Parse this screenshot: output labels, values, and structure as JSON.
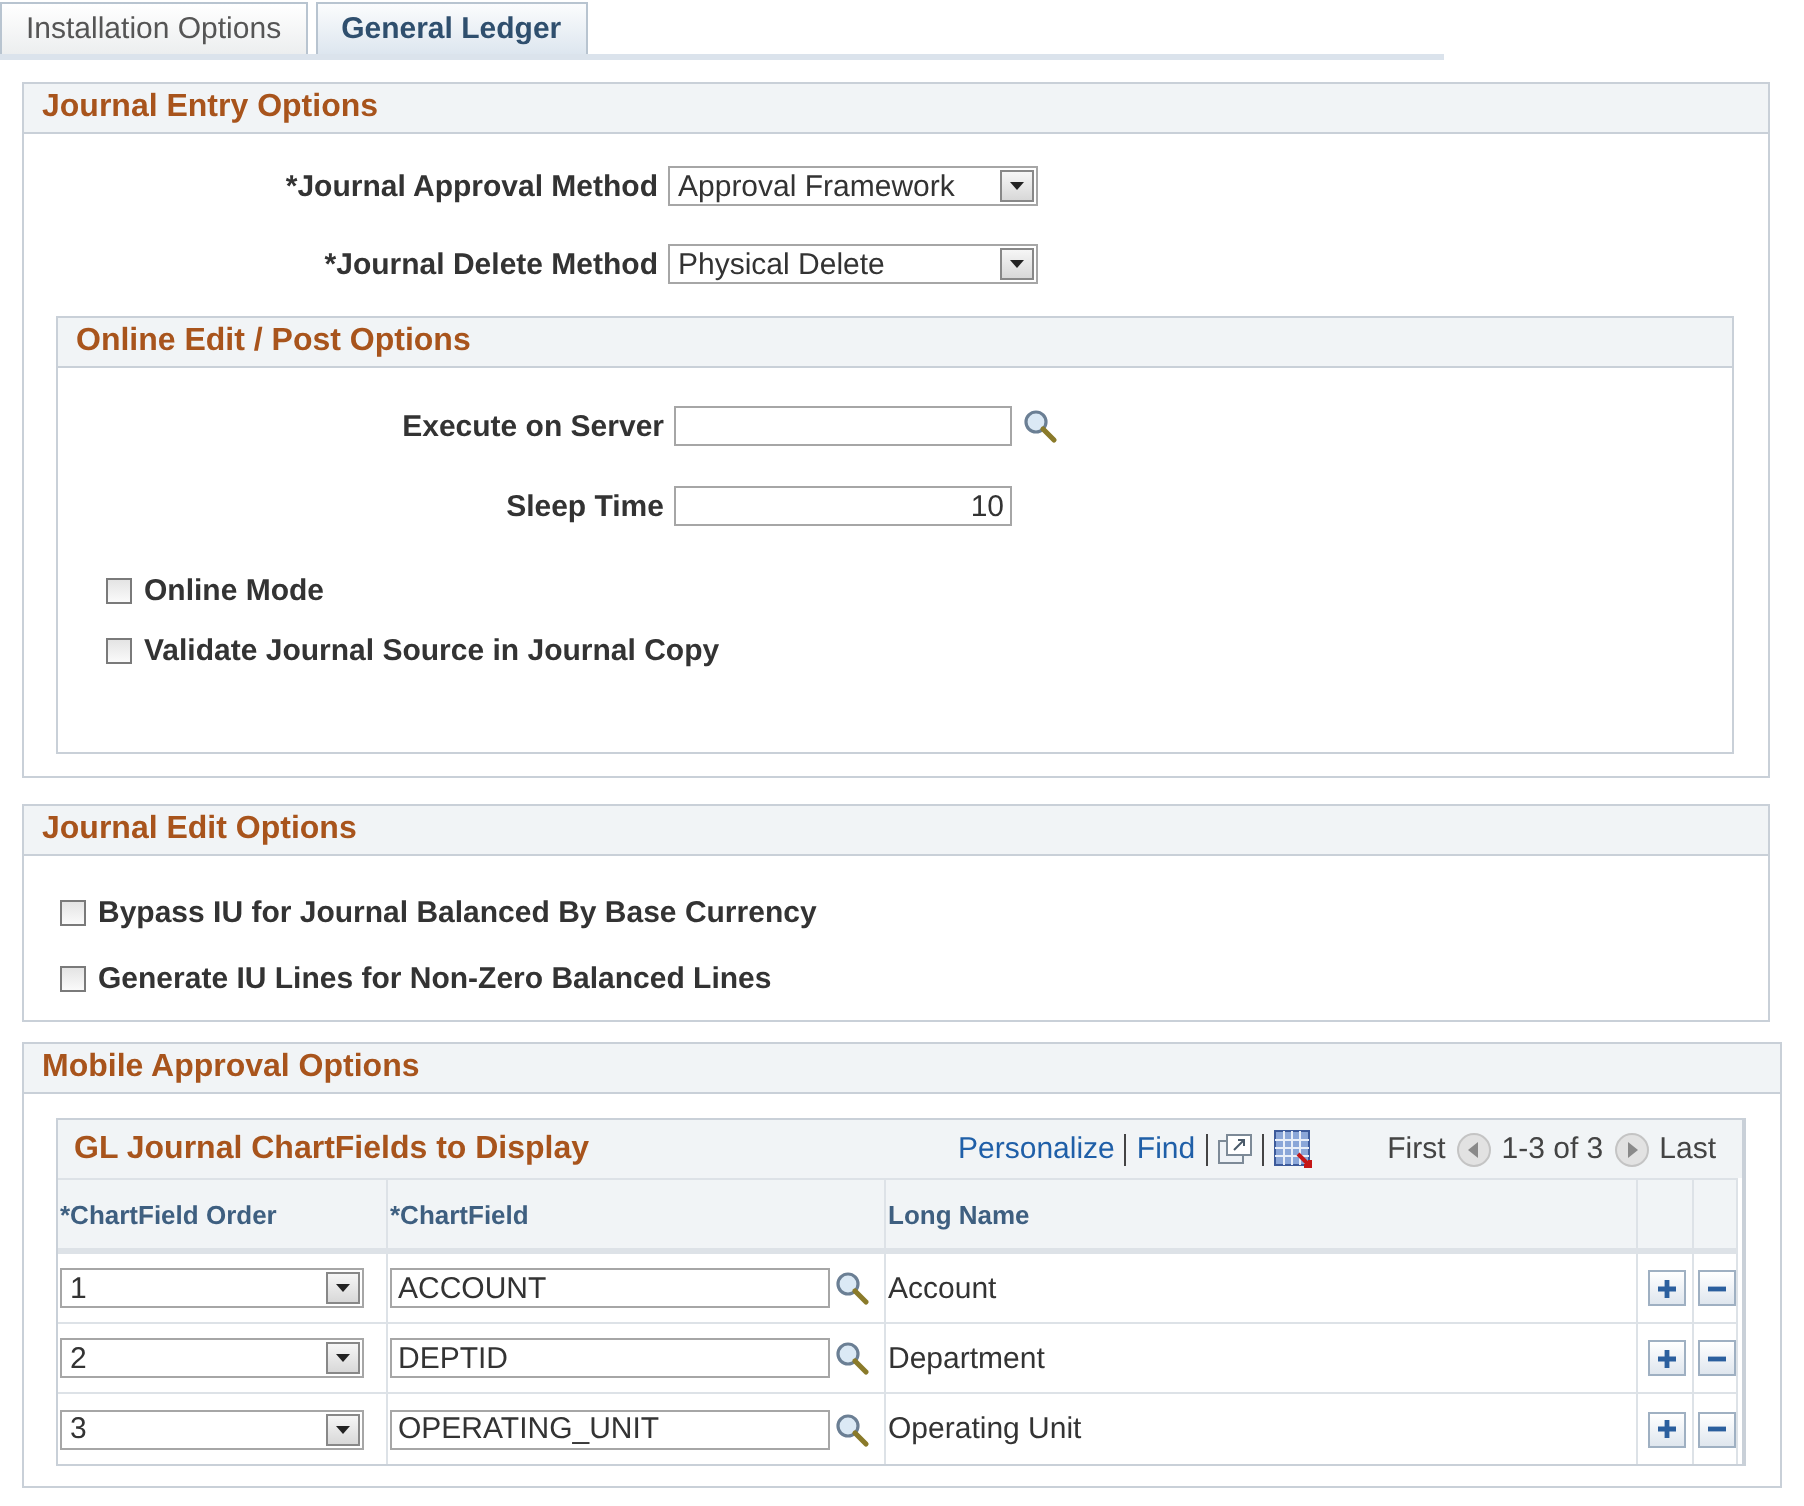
{
  "tabs": [
    {
      "label": "Installation Options",
      "selected": false
    },
    {
      "label": "General Ledger",
      "selected": true
    }
  ],
  "journal_entry": {
    "title": "Journal Entry Options",
    "fields": [
      {
        "label": "*Journal Approval Method",
        "value": "Approval Framework"
      },
      {
        "label": "*Journal Delete Method",
        "value": "Physical Delete"
      }
    ],
    "online_edit": {
      "title": "Online Edit / Post Options",
      "fields": [
        {
          "label": "Execute on Server",
          "kind": "lookup"
        },
        {
          "label": "Sleep Time",
          "value": "10",
          "kind": "number"
        }
      ],
      "checkboxes": [
        {
          "label": "Online Mode",
          "checked": false
        },
        {
          "label": "Validate Journal Source in Journal Copy",
          "checked": false
        }
      ]
    }
  },
  "journal_edit": {
    "title": "Journal Edit Options",
    "checkboxes": [
      {
        "label": "Bypass IU for Journal Balanced By Base Currency",
        "checked": false
      },
      {
        "label": "Generate IU Lines for Non-Zero Balanced Lines",
        "checked": false
      }
    ]
  },
  "mobile_approval": {
    "title": "Mobile Approval Options",
    "grid": {
      "title": "GL Journal ChartFields to Display",
      "links": [
        "Personalize",
        "Find"
      ],
      "nav": {
        "first": "First",
        "range": "1-3 of 3",
        "last": "Last"
      },
      "columns": [
        "*ChartField Order",
        "*ChartField",
        "Long Name"
      ],
      "rows": [
        {
          "order": "1",
          "chartfield": "ACCOUNT",
          "long_name": "Account"
        },
        {
          "order": "2",
          "chartfield": "DEPTID",
          "long_name": "Department"
        },
        {
          "order": "3",
          "chartfield": "OPERATING_UNIT",
          "long_name": "Operating Unit"
        }
      ]
    }
  }
}
